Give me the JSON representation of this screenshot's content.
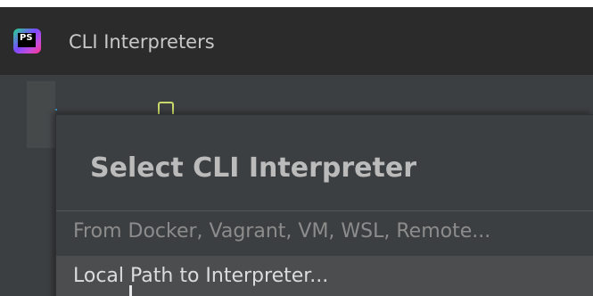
{
  "window": {
    "title": "CLI Interpreters",
    "app_icon_label": "PS"
  },
  "toolbar": {
    "add_icon": "plus-icon",
    "copy_icon": "copy-icon"
  },
  "popup": {
    "title": "Select CLI Interpreter",
    "options": [
      {
        "label": "From Docker, Vagrant, VM, WSL, Remote..."
      },
      {
        "label": "Local Path to Interpreter..."
      }
    ]
  },
  "colors": {
    "accent_add": "#3592c4",
    "accent_copy": "#c8d86b",
    "selected_row": "#4b4d4f"
  }
}
